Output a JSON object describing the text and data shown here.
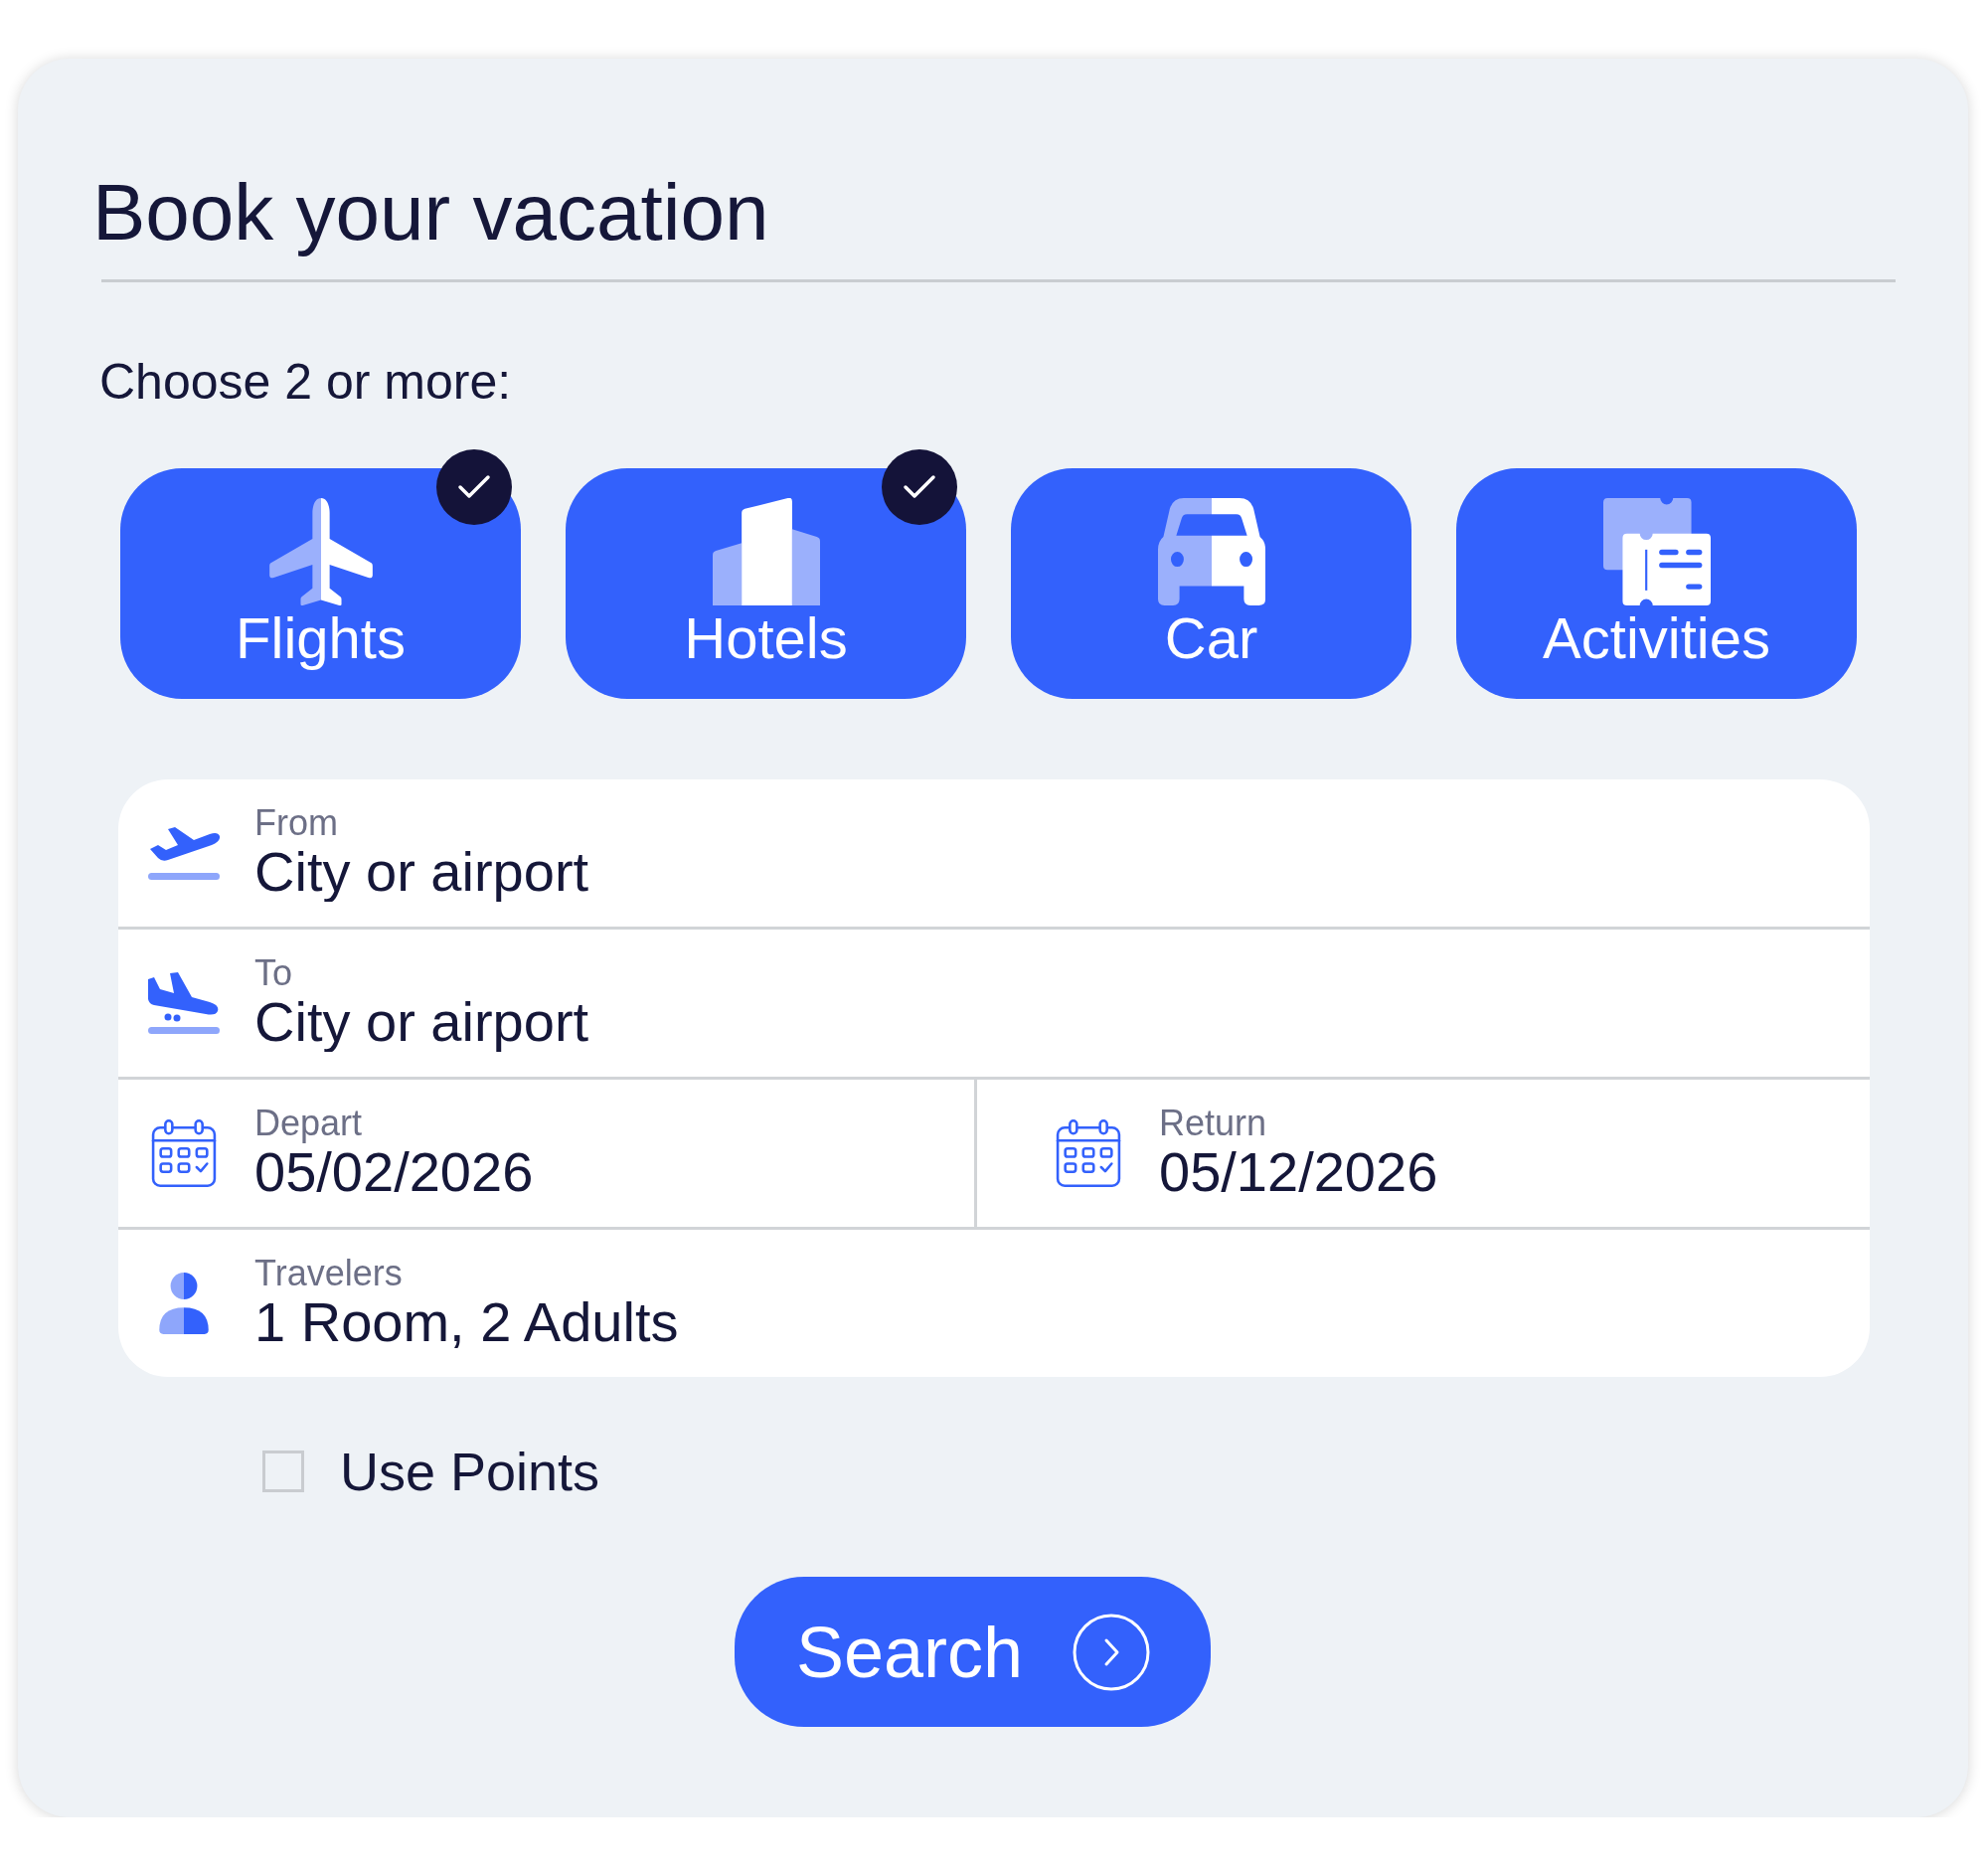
{
  "title": "Book your vacation",
  "prompt": "Choose 2 or more:",
  "categories": [
    {
      "kind": "flight",
      "label": "Flights",
      "selected": true
    },
    {
      "kind": "hotel",
      "label": "Hotels",
      "selected": true
    },
    {
      "kind": "car",
      "label": "Car",
      "selected": false
    },
    {
      "kind": "activity",
      "label": "Activities",
      "selected": false
    }
  ],
  "form": {
    "rows": [
      {
        "fields": [
          {
            "kind": "takeoff",
            "label": "From",
            "placeholder": "City or airport"
          }
        ]
      },
      {
        "fields": [
          {
            "kind": "landing",
            "label": "To",
            "placeholder": "City or airport"
          }
        ]
      },
      {
        "fields": [
          {
            "kind": "calendar",
            "label": "Depart",
            "value": "05/02/2026"
          },
          {
            "kind": "calendar",
            "label": "Return",
            "value": "05/12/2026"
          }
        ]
      },
      {
        "fields": [
          {
            "kind": "person",
            "label": "Travelers",
            "value": "1 Room, 2 Adults"
          }
        ]
      }
    ]
  },
  "use_points": {
    "label": "Use Points",
    "checked": false
  },
  "search_button": {
    "label": "Search"
  }
}
